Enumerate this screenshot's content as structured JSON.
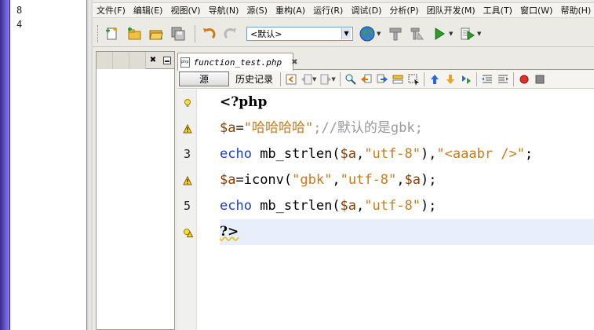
{
  "outside": {
    "numbers": [
      "8",
      "4"
    ]
  },
  "menu": [
    "文件(F)",
    "编辑(E)",
    "视图(V)",
    "导航(N)",
    "源(S)",
    "重构(A)",
    "运行(R)",
    "调试(D)",
    "分析(P)",
    "团队开发(M)",
    "工具(T)",
    "窗口(W)",
    "帮助(H)"
  ],
  "toolbar": {
    "config_value": "<默认>"
  },
  "editor": {
    "tab_name": "function_test.php",
    "source_label": "源",
    "history_label": "历史记录",
    "line_numbers": [
      "",
      "",
      "3",
      "",
      "5",
      ""
    ],
    "lines": [
      [
        {
          "t": "<?php",
          "c": "tk-tag"
        }
      ],
      [
        {
          "t": "$a",
          "c": "tk-var"
        },
        {
          "t": "=",
          "c": "tk-pl"
        },
        {
          "t": "\"哈哈哈哈\"",
          "c": "tk-str"
        },
        {
          "t": ";//默认的是gbk;",
          "c": "tk-cm"
        }
      ],
      [
        {
          "t": "echo",
          "c": "tk-kw"
        },
        {
          "t": " mb_strlen(",
          "c": "tk-fn"
        },
        {
          "t": "$a",
          "c": "tk-var"
        },
        {
          "t": ",",
          "c": "tk-pl"
        },
        {
          "t": "\"utf-8\"",
          "c": "tk-str"
        },
        {
          "t": "),",
          "c": "tk-pl"
        },
        {
          "t": "\"<aaabr />\"",
          "c": "tk-str"
        },
        {
          "t": ";",
          "c": "tk-pl"
        }
      ],
      [
        {
          "t": "$a",
          "c": "tk-var"
        },
        {
          "t": "=iconv(",
          "c": "tk-fn"
        },
        {
          "t": "\"gbk\"",
          "c": "tk-str"
        },
        {
          "t": ",",
          "c": "tk-pl"
        },
        {
          "t": "\"utf-8\"",
          "c": "tk-str"
        },
        {
          "t": ",",
          "c": "tk-pl"
        },
        {
          "t": "$a",
          "c": "tk-var"
        },
        {
          "t": ");",
          "c": "tk-pl"
        }
      ],
      [
        {
          "t": "echo",
          "c": "tk-kw"
        },
        {
          "t": " mb_strlen(",
          "c": "tk-fn"
        },
        {
          "t": "$a",
          "c": "tk-var"
        },
        {
          "t": ",",
          "c": "tk-pl"
        },
        {
          "t": "\"utf-8\"",
          "c": "tk-str"
        },
        {
          "t": ");",
          "c": "tk-pl"
        }
      ],
      [
        {
          "t": "?>",
          "c": "tk-tag"
        }
      ]
    ],
    "gutter_icons": [
      "bulb-icon",
      "warning-icon",
      "",
      "warning-icon",
      "",
      "bulb-warning-icon"
    ],
    "current_line": 5
  },
  "colors": {
    "keyword": "#1f3fbf",
    "string": "#c97a1a",
    "variable": "#8a3d00",
    "comment": "#9a9a9a",
    "current_line": "#e9effa"
  }
}
